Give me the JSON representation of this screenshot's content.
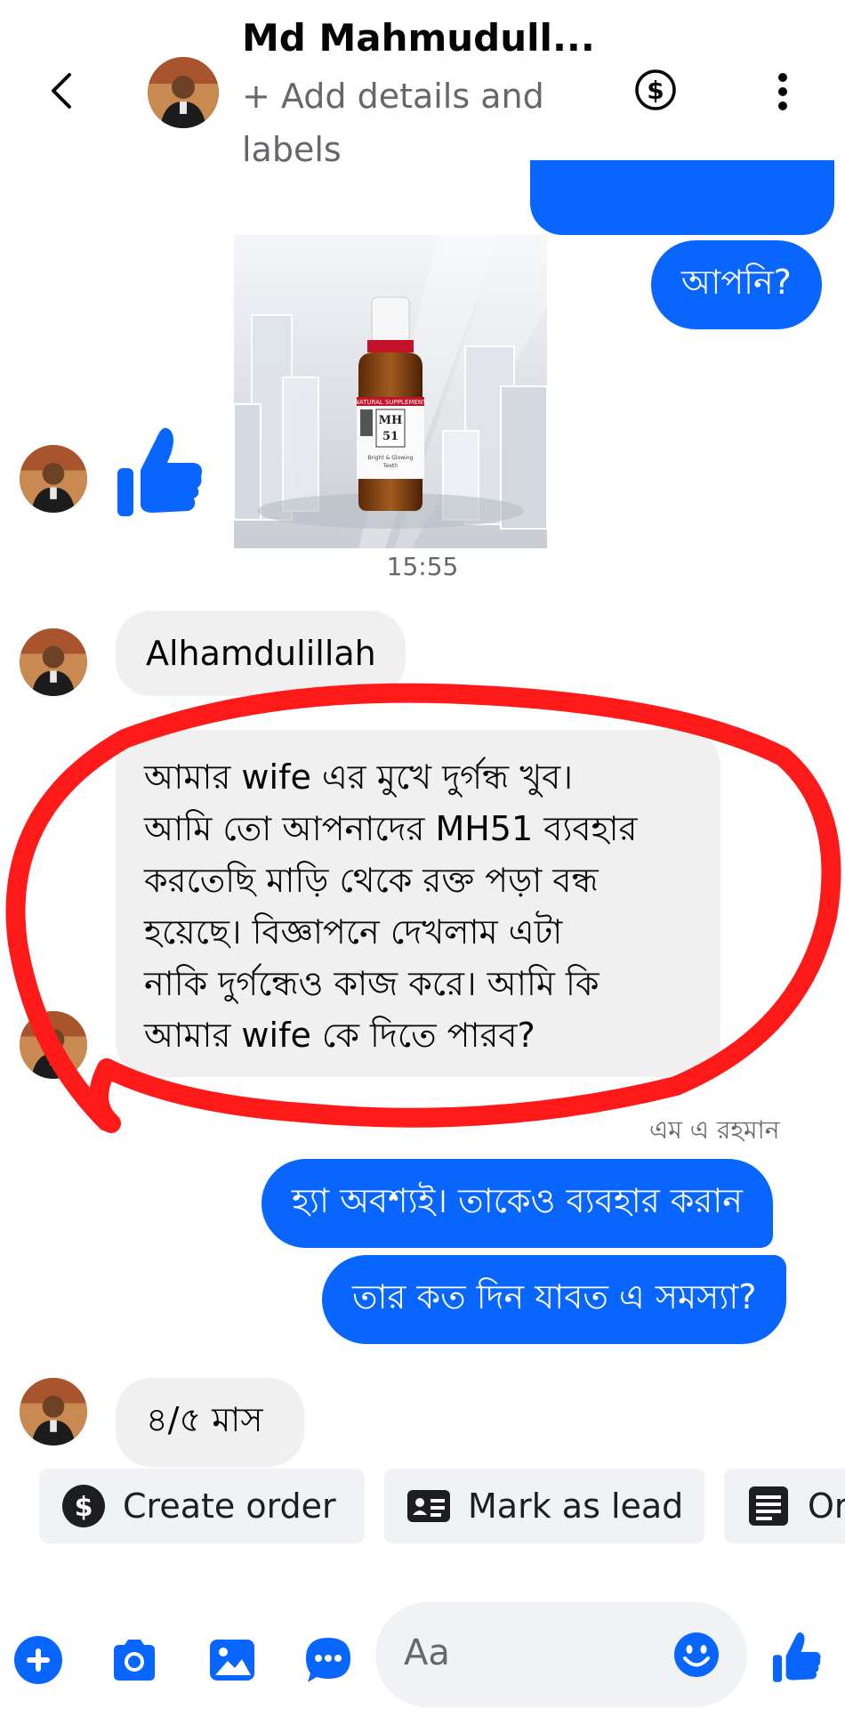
{
  "header": {
    "contact_name": "Md Mahmudull...",
    "subtitle": "+ Add details and labels"
  },
  "messages": {
    "out_1": "আপনি?",
    "image_time": "15:55",
    "in_1": "Alhamdulillah",
    "in_2_lines": [
      "আমার wife এর মুখে দুর্গন্ধ খুব।",
      "আমি তো আপনাদের MH51 ব্যবহার",
      "করতেছি মাড়ি থেকে রক্ত পড়া বন্ধ",
      "হয়েছে। বিজ্ঞাপনে দেখলাম এটা",
      "নাকি দুর্গন্ধেও কাজ করে। আমি কি",
      "আমার wife কে দিতে পারব?"
    ],
    "sender_note": "এম এ রহমান",
    "out_2": "হ্যা অবশ্যই। তাকেও ব্যবহার করান",
    "out_3": "তার কত দিন যাবত এ সমস্যা?",
    "in_3": "৪/৫ মাস"
  },
  "product_image": {
    "band_label": "NATURAL SUPPLEMENT",
    "code_line1": "MH",
    "code_line2": "51",
    "caption_line1": "Bright & Glowing",
    "caption_line2": "Teeth"
  },
  "quick_actions": [
    {
      "label": "Create order",
      "icon": "dollar-icon"
    },
    {
      "label": "Mark as lead",
      "icon": "id-card-icon"
    },
    {
      "label": "Or",
      "icon": "document-icon"
    }
  ],
  "composer": {
    "placeholder": "Aa"
  },
  "colors": {
    "accent": "#0866ff",
    "incoming_bubble": "#f0f0f0",
    "annotation_red": "#ff1a1a"
  }
}
